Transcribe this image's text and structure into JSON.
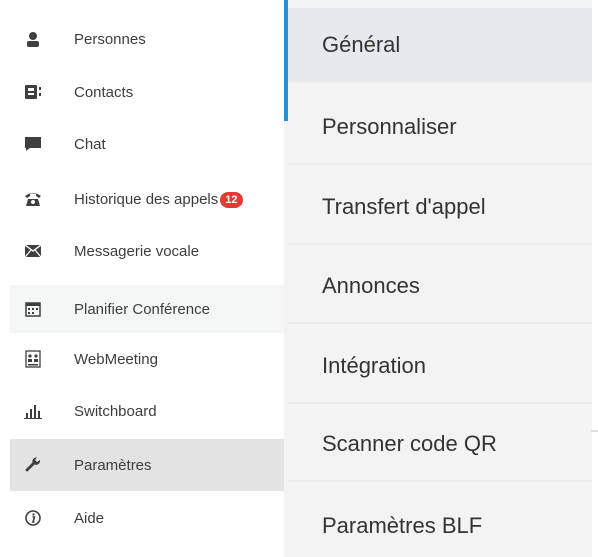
{
  "sidebar": {
    "items": [
      {
        "label": "Personnes",
        "icon": "person-icon"
      },
      {
        "label": "Contacts",
        "icon": "contacts-icon"
      },
      {
        "label": "Chat",
        "icon": "chat-icon"
      },
      {
        "label": "Historique des appels",
        "icon": "phone-icon",
        "badge": "12"
      },
      {
        "label": "Messagerie vocale",
        "icon": "envelope-icon"
      },
      {
        "label": "Planifier Conférence",
        "icon": "calendar-icon"
      },
      {
        "label": "WebMeeting",
        "icon": "webmeeting-icon"
      },
      {
        "label": "Switchboard",
        "icon": "bar-chart-icon"
      },
      {
        "label": "Paramètres",
        "icon": "wrench-icon"
      },
      {
        "label": "Aide",
        "icon": "info-icon"
      }
    ]
  },
  "settings_menu": {
    "items": [
      {
        "label": "Général"
      },
      {
        "label": "Personnaliser"
      },
      {
        "label": "Transfert d'appel"
      },
      {
        "label": "Annonces"
      },
      {
        "label": "Intégration"
      },
      {
        "label": "Scanner code QR"
      },
      {
        "label": "Paramètres BLF"
      }
    ]
  },
  "colors": {
    "accent": "#2f91c9",
    "badge": "#e53935",
    "active_sidebar": "#e3e3e3",
    "active_menu": "#e5e9ed"
  }
}
